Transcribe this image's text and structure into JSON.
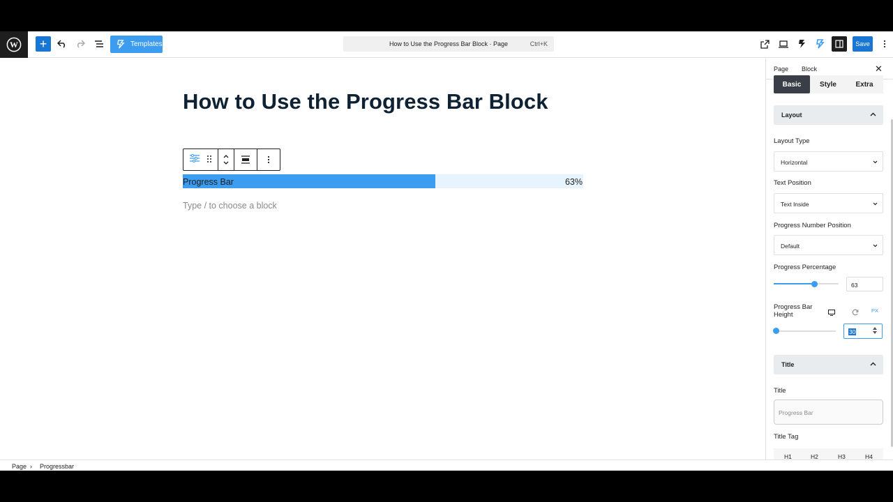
{
  "toolbar": {
    "templates_label": "Templates",
    "doc_title": "How to Use the Progress Bar Block · Page",
    "doc_shortcut": "Ctrl+K",
    "save_label": "Save"
  },
  "editor": {
    "post_title": "How to Use the Progress Bar Block",
    "progress": {
      "title": "Progress Bar",
      "percent_label": "63%",
      "value": 63,
      "fill_color": "#3b9cf0",
      "track_color": "#e8f4fd"
    },
    "appender_placeholder": "Type / to choose a block"
  },
  "footer": {
    "crumb_1": "Page",
    "crumb_2": "Progressbar"
  },
  "sidebar": {
    "tab_page": "Page",
    "tab_block": "Block",
    "seg_basic": "Basic",
    "seg_style": "Style",
    "seg_extra": "Extra",
    "layout_panel": "Layout",
    "layout_type_label": "Layout Type",
    "layout_type_value": "Horizontal",
    "text_position_label": "Text Position",
    "text_position_value": "Text Inside",
    "number_position_label": "Progress Number Position",
    "number_position_value": "Default",
    "percentage_label": "Progress Percentage",
    "percentage_value": "63",
    "height_label": "Progress Bar Height",
    "height_unit": "PX",
    "height_value": "30",
    "title_panel": "Title",
    "title_label": "Title",
    "title_placeholder": "Progress Bar",
    "title_tag_label": "Title Tag",
    "tags": [
      "H1",
      "H2",
      "H3",
      "H4"
    ]
  },
  "colors": {
    "accent": "#1976d2",
    "progress_blue": "#3b9cf0",
    "dark": "#1e1e1e"
  }
}
